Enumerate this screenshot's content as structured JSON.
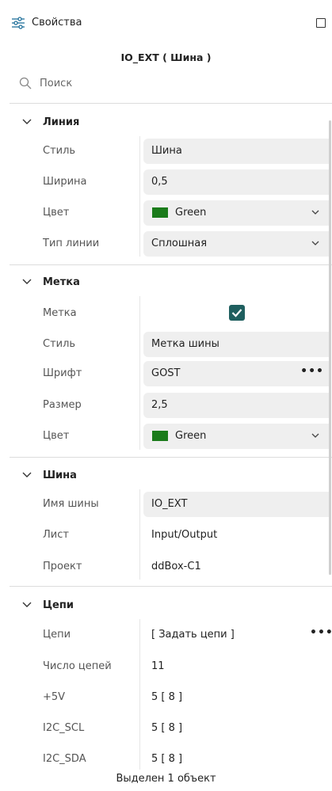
{
  "header": {
    "title": "Свойства",
    "icon": "properties-sliders-icon"
  },
  "object_title": "IO_EXT ( Шина )",
  "search": {
    "placeholder": "Поиск"
  },
  "sections": {
    "line": {
      "title": "Линия",
      "style": {
        "label": "Стиль",
        "value": "Шина"
      },
      "width": {
        "label": "Ширина",
        "value": "0,5"
      },
      "color": {
        "label": "Цвет",
        "value": "Green",
        "swatch": "#1a7b1a"
      },
      "linetype": {
        "label": "Тип линии",
        "value": "Сплошная"
      }
    },
    "label": {
      "title": "Метка",
      "enabled": {
        "label": "Метка",
        "checked": true
      },
      "style": {
        "label": "Стиль",
        "value": "Метка шины"
      },
      "font": {
        "label": "Шрифт",
        "value": "GOST",
        "more": "•••"
      },
      "size": {
        "label": "Размер",
        "value": "2,5"
      },
      "color": {
        "label": "Цвет",
        "value": "Green",
        "swatch": "#1a7b1a"
      }
    },
    "bus": {
      "title": "Шина",
      "name": {
        "label": "Имя шины",
        "value": "IO_EXT"
      },
      "sheet": {
        "label": "Лист",
        "value": "Input/Output"
      },
      "project": {
        "label": "Проект",
        "value": "ddBox-C1"
      }
    },
    "nets": {
      "title": "Цепи",
      "nets": {
        "label": "Цепи",
        "value": "[ Задать цепи ]",
        "more": "•••"
      },
      "count": {
        "label": "Число цепей",
        "value": "11"
      },
      "items": [
        {
          "label": "+5V",
          "value": "5 [ 8 ]"
        },
        {
          "label": "I2C_SCL",
          "value": "5 [ 8 ]"
        },
        {
          "label": "I2C_SDA",
          "value": "5 [ 8 ]"
        }
      ]
    }
  },
  "footer": {
    "status": "Выделен 1 объект"
  },
  "colors": {
    "accent": "#1f5f5f",
    "field_bg": "#efefef"
  }
}
